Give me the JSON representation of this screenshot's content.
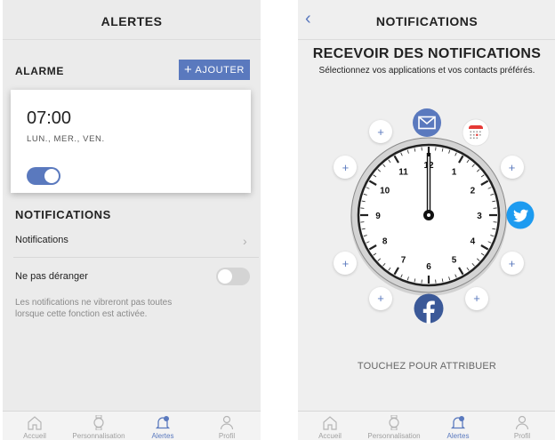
{
  "left": {
    "title": "ALERTES",
    "alarm_section": "ALARME",
    "add_plus": "+",
    "add_label": "AJOUTER",
    "alarm": {
      "time": "07:00",
      "days": "LUN., MER., VEN."
    },
    "notifications_section": "NOTIFICATIONS",
    "notifications_row": "Notifications",
    "chevron": "›",
    "dnd_label": "Ne pas déranger",
    "dnd_note": "Les notifications ne vibreront pas toutes lorsque cette fonction est activée."
  },
  "right": {
    "back": "‹",
    "title": "NOTIFICATIONS",
    "heading": "RECEVOIR DES NOTIFICATIONS",
    "subtitle": "Sélectionnez vos applications et vos contacts préférés.",
    "touch_hint": "TOUCHEZ POUR ATTRIBUER",
    "slot_plus": "+"
  },
  "clock_numbers": [
    "12",
    "1",
    "2",
    "3",
    "4",
    "5",
    "6",
    "7",
    "8",
    "9",
    "10",
    "11"
  ],
  "tabs": [
    "Accueil",
    "Personnalisation",
    "Alertes",
    "Profil"
  ],
  "colors": {
    "accent": "#5a79be",
    "twitter": "#1d9bf0",
    "facebook": "#3b5998",
    "calendar": "#e53935"
  }
}
